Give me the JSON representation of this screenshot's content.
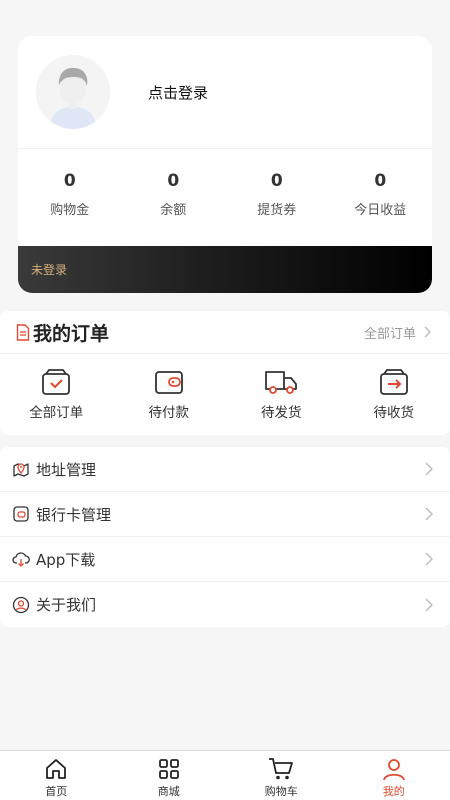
{
  "profile": {
    "login_prompt": "点击登录",
    "stats": [
      {
        "value": "0",
        "label": "购物金"
      },
      {
        "value": "0",
        "label": "余额"
      },
      {
        "value": "0",
        "label": "提货券"
      },
      {
        "value": "0",
        "label": "今日收益"
      }
    ],
    "member_status": "未登录"
  },
  "orders": {
    "title": "我的订单",
    "view_all": "全部订单",
    "items": [
      {
        "label": "全部订单",
        "icon": "box-check-icon"
      },
      {
        "label": "待付款",
        "icon": "wallet-icon"
      },
      {
        "label": "待发货",
        "icon": "truck-icon"
      },
      {
        "label": "待收货",
        "icon": "box-arrow-icon"
      }
    ]
  },
  "menu": [
    {
      "label": "地址管理",
      "icon": "map-pin-icon"
    },
    {
      "label": "银行卡管理",
      "icon": "card-icon"
    },
    {
      "label": "App下载",
      "icon": "cloud-download-icon"
    },
    {
      "label": "关于我们",
      "icon": "user-circle-icon"
    }
  ],
  "tabbar": [
    {
      "label": "首页",
      "icon": "home-icon"
    },
    {
      "label": "商城",
      "icon": "grid-icon"
    },
    {
      "label": "购物车",
      "icon": "cart-icon"
    },
    {
      "label": "我的",
      "icon": "user-icon",
      "active": true
    }
  ],
  "colors": {
    "accent": "#e0492f",
    "gold_text": "#d6b07a",
    "background": "#f6f6f6"
  }
}
